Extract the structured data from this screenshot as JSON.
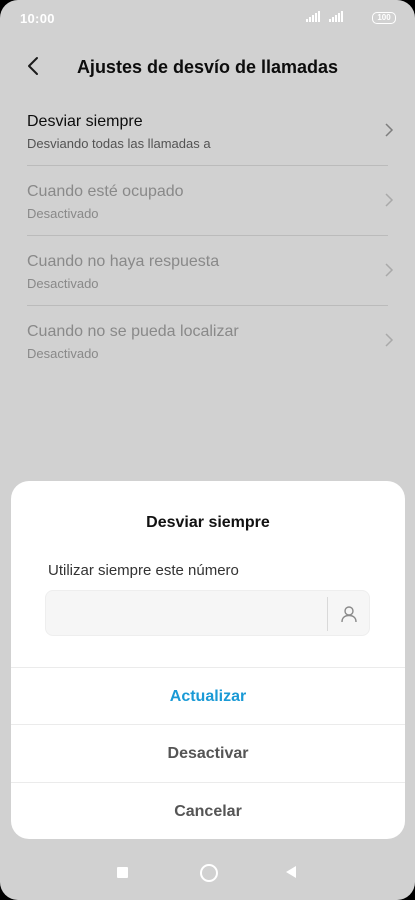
{
  "status_bar": {
    "time": "10:00",
    "battery": "100"
  },
  "header": {
    "title": "Ajustes de desvío de llamadas"
  },
  "list": {
    "items": [
      {
        "title": "Desviar siempre",
        "subtitle": "Desviando todas las llamadas a",
        "enabled": true
      },
      {
        "title": "Cuando esté ocupado",
        "subtitle": "Desactivado",
        "enabled": false
      },
      {
        "title": "Cuando no haya respuesta",
        "subtitle": "Desactivado",
        "enabled": false
      },
      {
        "title": "Cuando no se pueda localizar",
        "subtitle": "Desactivado",
        "enabled": false
      }
    ]
  },
  "dialog": {
    "title": "Desviar siempre",
    "label": "Utilizar siempre este número",
    "input_value": "",
    "update_label": "Actualizar",
    "disable_label": "Desactivar",
    "cancel_label": "Cancelar",
    "accent_color": "#1a9ad6"
  },
  "icons": {
    "back": "chevron-left-icon",
    "chevron": "chevron-right-icon",
    "contact": "person-icon",
    "nav_recents": "square-icon",
    "nav_home": "circle-icon",
    "nav_back": "triangle-back-icon"
  }
}
